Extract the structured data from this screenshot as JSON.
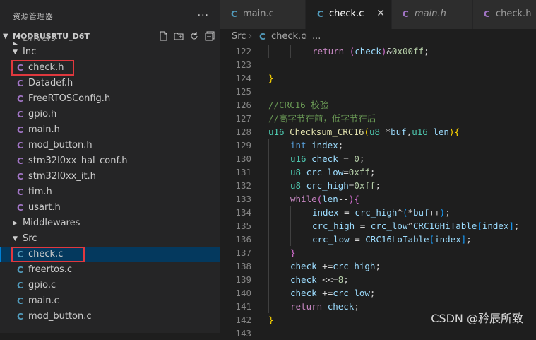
{
  "explorer": {
    "title": "资源管理器",
    "more": "···",
    "project": "MODBUSRTU_D6T",
    "action_icons": [
      "new-file-icon",
      "new-folder-icon",
      "refresh-icon",
      "collapse-all-icon"
    ]
  },
  "tree": [
    {
      "type": "folder",
      "name": "Drivers",
      "expanded": false,
      "cutoff": true
    },
    {
      "type": "folder",
      "name": "Inc",
      "expanded": true
    },
    {
      "type": "file",
      "name": "check.h",
      "ext": "h",
      "highlight": true
    },
    {
      "type": "file",
      "name": "Datadef.h",
      "ext": "h"
    },
    {
      "type": "file",
      "name": "FreeRTOSConfig.h",
      "ext": "h"
    },
    {
      "type": "file",
      "name": "gpio.h",
      "ext": "h"
    },
    {
      "type": "file",
      "name": "main.h",
      "ext": "h"
    },
    {
      "type": "file",
      "name": "mod_button.h",
      "ext": "h"
    },
    {
      "type": "file",
      "name": "stm32l0xx_hal_conf.h",
      "ext": "h"
    },
    {
      "type": "file",
      "name": "stm32l0xx_it.h",
      "ext": "h"
    },
    {
      "type": "file",
      "name": "tim.h",
      "ext": "h"
    },
    {
      "type": "file",
      "name": "usart.h",
      "ext": "h"
    },
    {
      "type": "folder",
      "name": "Middlewares",
      "expanded": false
    },
    {
      "type": "folder",
      "name": "Src",
      "expanded": true
    },
    {
      "type": "file",
      "name": "check.c",
      "ext": "c",
      "selected": true,
      "highlight": true
    },
    {
      "type": "file",
      "name": "freertos.c",
      "ext": "c"
    },
    {
      "type": "file",
      "name": "gpio.c",
      "ext": "c"
    },
    {
      "type": "file",
      "name": "main.c",
      "ext": "c"
    },
    {
      "type": "file",
      "name": "mod_button.c",
      "ext": "c"
    }
  ],
  "file_icon_glyph": "C",
  "colors": {
    "c_icon": "#519aba",
    "h_icon": "#a074c4",
    "selection": "#04395e",
    "highlight_box": "#e0383e"
  },
  "tabs": [
    {
      "label": "main.c",
      "ext": "c",
      "active": false,
      "italic": false
    },
    {
      "label": "check.c",
      "ext": "c",
      "active": true,
      "italic": false,
      "close": "✕"
    },
    {
      "label": "main.h",
      "ext": "h",
      "active": false,
      "italic": true
    },
    {
      "label": "check.h",
      "ext": "h",
      "active": false,
      "italic": false
    }
  ],
  "breadcrumb": {
    "folder": "Src",
    "sep": "›",
    "file": "check.c",
    "tail": "..."
  },
  "lines": [
    {
      "n": "122",
      "indent": 2,
      "code": [
        [
          "ctl",
          "return "
        ],
        [
          "br2",
          "("
        ],
        [
          "vr",
          "check"
        ],
        [
          "br2",
          ")"
        ],
        [
          "p",
          "&"
        ],
        [
          "num",
          "0x00ff"
        ],
        [
          "p",
          ";"
        ]
      ]
    },
    {
      "n": "123",
      "indent": 0,
      "code": []
    },
    {
      "n": "124",
      "indent": 0,
      "code": [
        [
          "br1",
          "}"
        ]
      ]
    },
    {
      "n": "125",
      "indent": 0,
      "code": []
    },
    {
      "n": "126",
      "indent": 0,
      "code": [
        [
          "cm",
          "//CRC16 校验"
        ]
      ]
    },
    {
      "n": "127",
      "indent": 0,
      "code": [
        [
          "cm",
          "//高字节在前，低字节在后"
        ]
      ]
    },
    {
      "n": "128",
      "indent": 0,
      "code": [
        [
          "ty",
          "u16 "
        ],
        [
          "fn",
          "Checksum_CRC16"
        ],
        [
          "br1",
          "("
        ],
        [
          "ty",
          "u8 "
        ],
        [
          "p",
          "*"
        ],
        [
          "vr",
          "buf"
        ],
        [
          "p",
          ","
        ],
        [
          "ty",
          "u16 "
        ],
        [
          "vr",
          "len"
        ],
        [
          "br1",
          ")"
        ],
        [
          "br1",
          "{"
        ]
      ]
    },
    {
      "n": "129",
      "indent": 1,
      "code": [
        [
          "kw",
          "int "
        ],
        [
          "vr",
          "index"
        ],
        [
          "p",
          ";"
        ]
      ]
    },
    {
      "n": "130",
      "indent": 1,
      "code": [
        [
          "ty",
          "u16 "
        ],
        [
          "vr",
          "check"
        ],
        [
          "p",
          " = "
        ],
        [
          "num",
          "0"
        ],
        [
          "p",
          ";"
        ]
      ]
    },
    {
      "n": "131",
      "indent": 1,
      "code": [
        [
          "ty",
          "u8 "
        ],
        [
          "vr",
          "crc_low"
        ],
        [
          "p",
          "="
        ],
        [
          "num",
          "0xff"
        ],
        [
          "p",
          ";"
        ]
      ]
    },
    {
      "n": "132",
      "indent": 1,
      "code": [
        [
          "ty",
          "u8 "
        ],
        [
          "vr",
          "crc_high"
        ],
        [
          "p",
          "="
        ],
        [
          "num",
          "0xff"
        ],
        [
          "p",
          ";"
        ]
      ]
    },
    {
      "n": "133",
      "indent": 1,
      "code": [
        [
          "ctl",
          "while"
        ],
        [
          "br2",
          "("
        ],
        [
          "vr",
          "len"
        ],
        [
          "p",
          "--"
        ],
        [
          "br2",
          ")"
        ],
        [
          "br2",
          "{"
        ]
      ]
    },
    {
      "n": "134",
      "indent": 2,
      "code": [
        [
          "vr",
          "index"
        ],
        [
          "p",
          " = "
        ],
        [
          "vr",
          "crc_high"
        ],
        [
          "p",
          "^"
        ],
        [
          "br3",
          "("
        ],
        [
          "p",
          "*"
        ],
        [
          "vr",
          "buf"
        ],
        [
          "p",
          "++"
        ],
        [
          "br3",
          ")"
        ],
        [
          "p",
          ";"
        ]
      ]
    },
    {
      "n": "135",
      "indent": 2,
      "code": [
        [
          "vr",
          "crc_high"
        ],
        [
          "p",
          " = "
        ],
        [
          "vr",
          "crc_low"
        ],
        [
          "p",
          "^"
        ],
        [
          "vr",
          "CRC16HiTable"
        ],
        [
          "br3",
          "["
        ],
        [
          "vr",
          "index"
        ],
        [
          "br3",
          "]"
        ],
        [
          "p",
          ";"
        ]
      ]
    },
    {
      "n": "136",
      "indent": 2,
      "code": [
        [
          "vr",
          "crc_low"
        ],
        [
          "p",
          " = "
        ],
        [
          "vr",
          "CRC16LoTable"
        ],
        [
          "br3",
          "["
        ],
        [
          "vr",
          "index"
        ],
        [
          "br3",
          "]"
        ],
        [
          "p",
          ";"
        ]
      ]
    },
    {
      "n": "137",
      "indent": 1,
      "code": [
        [
          "br2",
          "}"
        ]
      ]
    },
    {
      "n": "138",
      "indent": 1,
      "code": [
        [
          "vr",
          "check"
        ],
        [
          "p",
          " +="
        ],
        [
          "vr",
          "crc_high"
        ],
        [
          "p",
          ";"
        ]
      ]
    },
    {
      "n": "139",
      "indent": 1,
      "code": [
        [
          "vr",
          "check"
        ],
        [
          "p",
          " <<="
        ],
        [
          "num",
          "8"
        ],
        [
          "p",
          ";"
        ]
      ]
    },
    {
      "n": "140",
      "indent": 1,
      "code": [
        [
          "vr",
          "check"
        ],
        [
          "p",
          " +="
        ],
        [
          "vr",
          "crc_low"
        ],
        [
          "p",
          ";"
        ]
      ]
    },
    {
      "n": "141",
      "indent": 1,
      "code": [
        [
          "ctl",
          "return "
        ],
        [
          "vr",
          "check"
        ],
        [
          "p",
          ";"
        ]
      ]
    },
    {
      "n": "142",
      "indent": 0,
      "code": [
        [
          "br1",
          "}"
        ]
      ]
    },
    {
      "n": "143",
      "indent": 0,
      "code": []
    }
  ],
  "watermark": "CSDN @矜辰所致"
}
